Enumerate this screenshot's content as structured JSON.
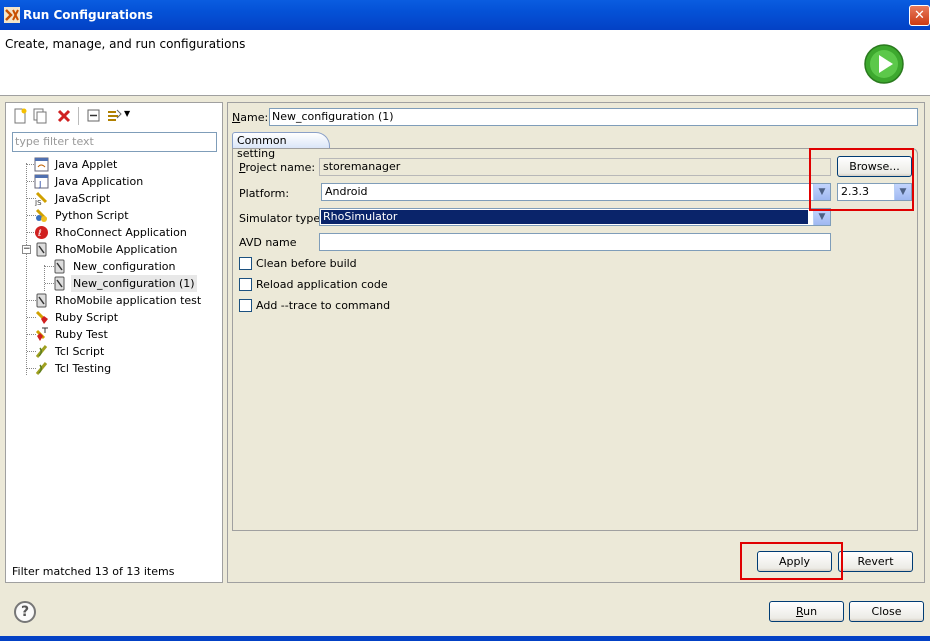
{
  "window": {
    "title": "Run Configurations",
    "close_label": "✕"
  },
  "header": {
    "subtitle": "Create, manage, and run configurations"
  },
  "left_panel": {
    "filter_placeholder": "type filter text",
    "tree": [
      {
        "label": "Java Applet",
        "icon": "java-applet-icon"
      },
      {
        "label": "Java Application",
        "icon": "java-application-icon"
      },
      {
        "label": "JavaScript",
        "icon": "javascript-icon"
      },
      {
        "label": "Python Script",
        "icon": "python-script-icon"
      },
      {
        "label": "RhoConnect Application",
        "icon": "rhoconnect-icon"
      },
      {
        "label": "RhoMobile Application",
        "icon": "rhomobile-icon",
        "expanded": true
      },
      {
        "label": "New_configuration",
        "icon": "config-icon"
      },
      {
        "label": "New_configuration (1)",
        "icon": "config-icon",
        "selected": true
      },
      {
        "label": "RhoMobile application test",
        "icon": "rhomobile-test-icon"
      },
      {
        "label": "Ruby Script",
        "icon": "ruby-script-icon"
      },
      {
        "label": "Ruby Test",
        "icon": "ruby-test-icon"
      },
      {
        "label": "Tcl Script",
        "icon": "tcl-script-icon"
      },
      {
        "label": "Tcl Testing",
        "icon": "tcl-testing-icon"
      }
    ],
    "filter_status": "Filter matched 13 of 13 items"
  },
  "config": {
    "name_label": "Name:",
    "name_value": "New_configuration (1)",
    "tab_label": "Common setting",
    "project_label": "Project name:",
    "project_value": "storemanager",
    "browse_label": "Browse...",
    "platform_label": "Platform:",
    "platform_value": "Android",
    "version_value": "2.3.3",
    "simulator_label": "Simulator type:",
    "simulator_value": "RhoSimulator",
    "avd_label": "AVD name",
    "avd_value": "",
    "clean_label": "Clean before build",
    "reload_label": "Reload application code",
    "trace_label": "Add --trace to command",
    "apply_label": "Apply",
    "revert_label": "Revert"
  },
  "footer": {
    "run_label": "Run",
    "close_label": "Close",
    "help_glyph": "?"
  },
  "colors": {
    "titlebar": "#0451d6",
    "highlight_box": "#e00000",
    "selection": "#0a246a"
  }
}
